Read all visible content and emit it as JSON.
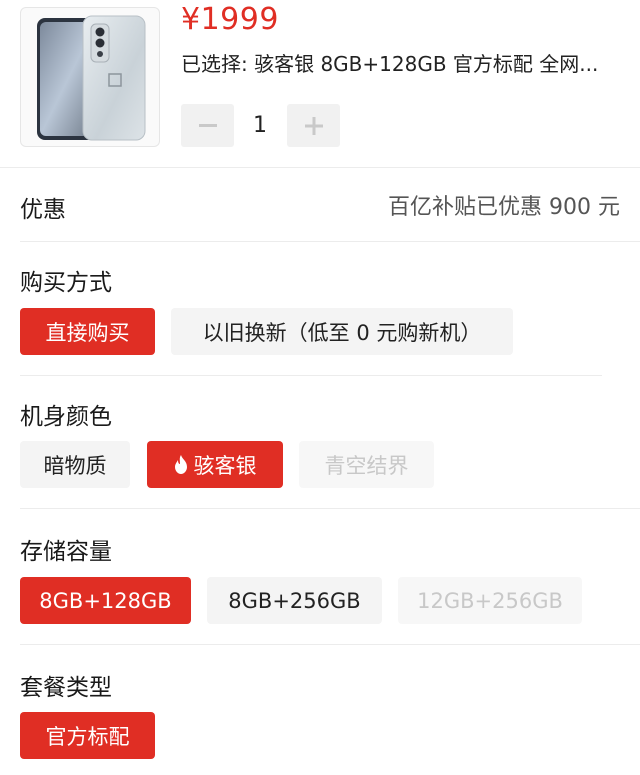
{
  "product": {
    "price": "¥1999",
    "selected_text": "已选择: 骇客银 8GB+128GB 官方标配 全网...",
    "quantity": "1"
  },
  "promo": {
    "label": "优惠",
    "value": "百亿补贴已优惠 900 元"
  },
  "purchase_method": {
    "label": "购买方式",
    "options": [
      "直接购买",
      "以旧换新（低至 0 元购新机）"
    ],
    "selected_index": 0
  },
  "color": {
    "label": "机身颜色",
    "options": [
      "暗物质",
      "骇客银",
      "青空结界"
    ],
    "selected_index": 1,
    "disabled_index": 2
  },
  "storage": {
    "label": "存储容量",
    "options": [
      "8GB+128GB",
      "8GB+256GB",
      "12GB+256GB"
    ],
    "selected_index": 0,
    "disabled_index": 2
  },
  "package": {
    "label": "套餐类型",
    "options": [
      "官方标配"
    ],
    "selected_index": 0
  },
  "colors": {
    "accent": "#e02e24",
    "chip_bg": "#f4f4f4",
    "disabled_text": "#c8c8c8"
  },
  "icons": {
    "minus": "minus-icon",
    "plus": "plus-icon",
    "fire": "fire-icon"
  }
}
